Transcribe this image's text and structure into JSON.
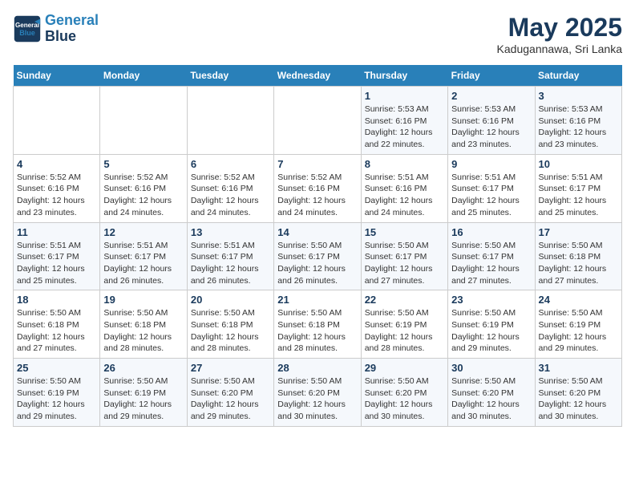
{
  "header": {
    "logo_line1": "General",
    "logo_line2": "Blue",
    "month_title": "May 2025",
    "location": "Kadugannawa, Sri Lanka"
  },
  "days_of_week": [
    "Sunday",
    "Monday",
    "Tuesday",
    "Wednesday",
    "Thursday",
    "Friday",
    "Saturday"
  ],
  "weeks": [
    [
      {
        "day": "",
        "info": ""
      },
      {
        "day": "",
        "info": ""
      },
      {
        "day": "",
        "info": ""
      },
      {
        "day": "",
        "info": ""
      },
      {
        "day": "1",
        "info": "Sunrise: 5:53 AM\nSunset: 6:16 PM\nDaylight: 12 hours\nand 22 minutes."
      },
      {
        "day": "2",
        "info": "Sunrise: 5:53 AM\nSunset: 6:16 PM\nDaylight: 12 hours\nand 23 minutes."
      },
      {
        "day": "3",
        "info": "Sunrise: 5:53 AM\nSunset: 6:16 PM\nDaylight: 12 hours\nand 23 minutes."
      }
    ],
    [
      {
        "day": "4",
        "info": "Sunrise: 5:52 AM\nSunset: 6:16 PM\nDaylight: 12 hours\nand 23 minutes."
      },
      {
        "day": "5",
        "info": "Sunrise: 5:52 AM\nSunset: 6:16 PM\nDaylight: 12 hours\nand 24 minutes."
      },
      {
        "day": "6",
        "info": "Sunrise: 5:52 AM\nSunset: 6:16 PM\nDaylight: 12 hours\nand 24 minutes."
      },
      {
        "day": "7",
        "info": "Sunrise: 5:52 AM\nSunset: 6:16 PM\nDaylight: 12 hours\nand 24 minutes."
      },
      {
        "day": "8",
        "info": "Sunrise: 5:51 AM\nSunset: 6:16 PM\nDaylight: 12 hours\nand 24 minutes."
      },
      {
        "day": "9",
        "info": "Sunrise: 5:51 AM\nSunset: 6:17 PM\nDaylight: 12 hours\nand 25 minutes."
      },
      {
        "day": "10",
        "info": "Sunrise: 5:51 AM\nSunset: 6:17 PM\nDaylight: 12 hours\nand 25 minutes."
      }
    ],
    [
      {
        "day": "11",
        "info": "Sunrise: 5:51 AM\nSunset: 6:17 PM\nDaylight: 12 hours\nand 25 minutes."
      },
      {
        "day": "12",
        "info": "Sunrise: 5:51 AM\nSunset: 6:17 PM\nDaylight: 12 hours\nand 26 minutes."
      },
      {
        "day": "13",
        "info": "Sunrise: 5:51 AM\nSunset: 6:17 PM\nDaylight: 12 hours\nand 26 minutes."
      },
      {
        "day": "14",
        "info": "Sunrise: 5:50 AM\nSunset: 6:17 PM\nDaylight: 12 hours\nand 26 minutes."
      },
      {
        "day": "15",
        "info": "Sunrise: 5:50 AM\nSunset: 6:17 PM\nDaylight: 12 hours\nand 27 minutes."
      },
      {
        "day": "16",
        "info": "Sunrise: 5:50 AM\nSunset: 6:17 PM\nDaylight: 12 hours\nand 27 minutes."
      },
      {
        "day": "17",
        "info": "Sunrise: 5:50 AM\nSunset: 6:18 PM\nDaylight: 12 hours\nand 27 minutes."
      }
    ],
    [
      {
        "day": "18",
        "info": "Sunrise: 5:50 AM\nSunset: 6:18 PM\nDaylight: 12 hours\nand 27 minutes."
      },
      {
        "day": "19",
        "info": "Sunrise: 5:50 AM\nSunset: 6:18 PM\nDaylight: 12 hours\nand 28 minutes."
      },
      {
        "day": "20",
        "info": "Sunrise: 5:50 AM\nSunset: 6:18 PM\nDaylight: 12 hours\nand 28 minutes."
      },
      {
        "day": "21",
        "info": "Sunrise: 5:50 AM\nSunset: 6:18 PM\nDaylight: 12 hours\nand 28 minutes."
      },
      {
        "day": "22",
        "info": "Sunrise: 5:50 AM\nSunset: 6:19 PM\nDaylight: 12 hours\nand 28 minutes."
      },
      {
        "day": "23",
        "info": "Sunrise: 5:50 AM\nSunset: 6:19 PM\nDaylight: 12 hours\nand 29 minutes."
      },
      {
        "day": "24",
        "info": "Sunrise: 5:50 AM\nSunset: 6:19 PM\nDaylight: 12 hours\nand 29 minutes."
      }
    ],
    [
      {
        "day": "25",
        "info": "Sunrise: 5:50 AM\nSunset: 6:19 PM\nDaylight: 12 hours\nand 29 minutes."
      },
      {
        "day": "26",
        "info": "Sunrise: 5:50 AM\nSunset: 6:19 PM\nDaylight: 12 hours\nand 29 minutes."
      },
      {
        "day": "27",
        "info": "Sunrise: 5:50 AM\nSunset: 6:20 PM\nDaylight: 12 hours\nand 29 minutes."
      },
      {
        "day": "28",
        "info": "Sunrise: 5:50 AM\nSunset: 6:20 PM\nDaylight: 12 hours\nand 30 minutes."
      },
      {
        "day": "29",
        "info": "Sunrise: 5:50 AM\nSunset: 6:20 PM\nDaylight: 12 hours\nand 30 minutes."
      },
      {
        "day": "30",
        "info": "Sunrise: 5:50 AM\nSunset: 6:20 PM\nDaylight: 12 hours\nand 30 minutes."
      },
      {
        "day": "31",
        "info": "Sunrise: 5:50 AM\nSunset: 6:20 PM\nDaylight: 12 hours\nand 30 minutes."
      }
    ]
  ]
}
